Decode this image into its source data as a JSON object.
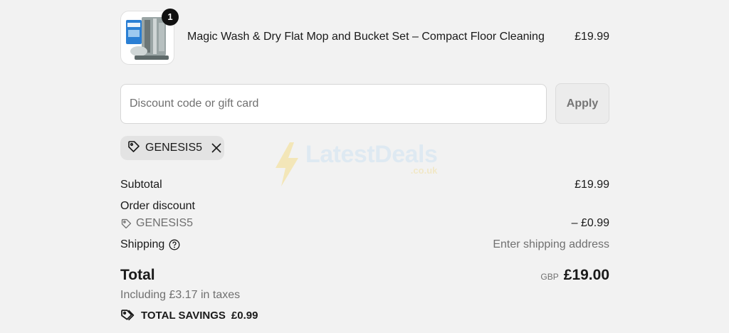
{
  "product": {
    "quantity": "1",
    "name": "Magic Wash & Dry Flat Mop and Bucket Set – Compact Floor Cleaning",
    "price": "£19.99",
    "image_icon": "mop-bucket-product-image"
  },
  "discount": {
    "placeholder": "Discount code or gift card",
    "value": "",
    "apply_label": "Apply",
    "applied_code": "GENESIS5"
  },
  "summary": {
    "subtotal_label": "Subtotal",
    "subtotal_value": "£19.99",
    "order_discount_label": "Order discount",
    "discount_code": "GENESIS5",
    "discount_value": "– £0.99",
    "shipping_label": "Shipping",
    "shipping_value": "Enter shipping address",
    "total_label": "Total",
    "total_currency": "GBP",
    "total_value": "£19.00",
    "tax_note": "Including £3.17 in taxes",
    "savings_label": "TOTAL SAVINGS",
    "savings_value": "£0.99"
  },
  "watermark": {
    "brand": "LatestDeals",
    "domain": ".co.uk"
  },
  "colors": {
    "background": "#f2f2f2",
    "badge": "#111111",
    "muted_text": "#707070"
  }
}
